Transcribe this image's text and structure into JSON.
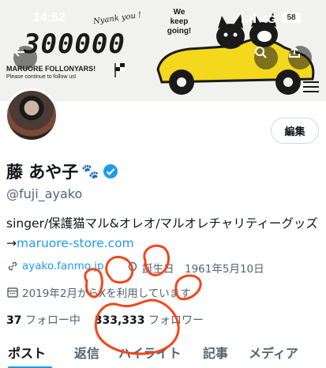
{
  "status_bar": {
    "time": "14:52",
    "network": "4G",
    "battery": "58"
  },
  "banner": {
    "big_number": "300000",
    "thanks": "Nyank you !",
    "line1": "MARUORE FOLLONYARS!",
    "line2": "Please continue to follow us!",
    "keep_going": [
      "We",
      "keep",
      "going!"
    ]
  },
  "nav": {
    "back_icon": "arrow-left-icon",
    "search_icon": "search-icon",
    "share_icon": "share-icon",
    "menu_icon": "hamburger-icon"
  },
  "profile": {
    "edit_label": "編集",
    "display_name": "藤 あや子",
    "name_emoji": "🐾",
    "handle": "@fuji_ayako",
    "bio_text": "singer/保護猫マル&オレオ/マルオレチャリティーグッズ→",
    "bio_link": "maruore-store.com",
    "website": "ayako.fanmo.jp",
    "birthday": "誕生日　1961年5月10日",
    "joined": "2019年2月からXを利用しています",
    "following_count": "37",
    "following_label": "フォロー中",
    "followers_count": "333,333",
    "followers_label": "フォロワー"
  },
  "tabs": [
    "ポスト",
    "返信",
    "ハイライト",
    "記事",
    "メディア"
  ],
  "colors": {
    "accent": "#1d9bf0",
    "doodle": "#f2461c",
    "verified": "#1d9bf0",
    "car": "#f4d81d"
  }
}
